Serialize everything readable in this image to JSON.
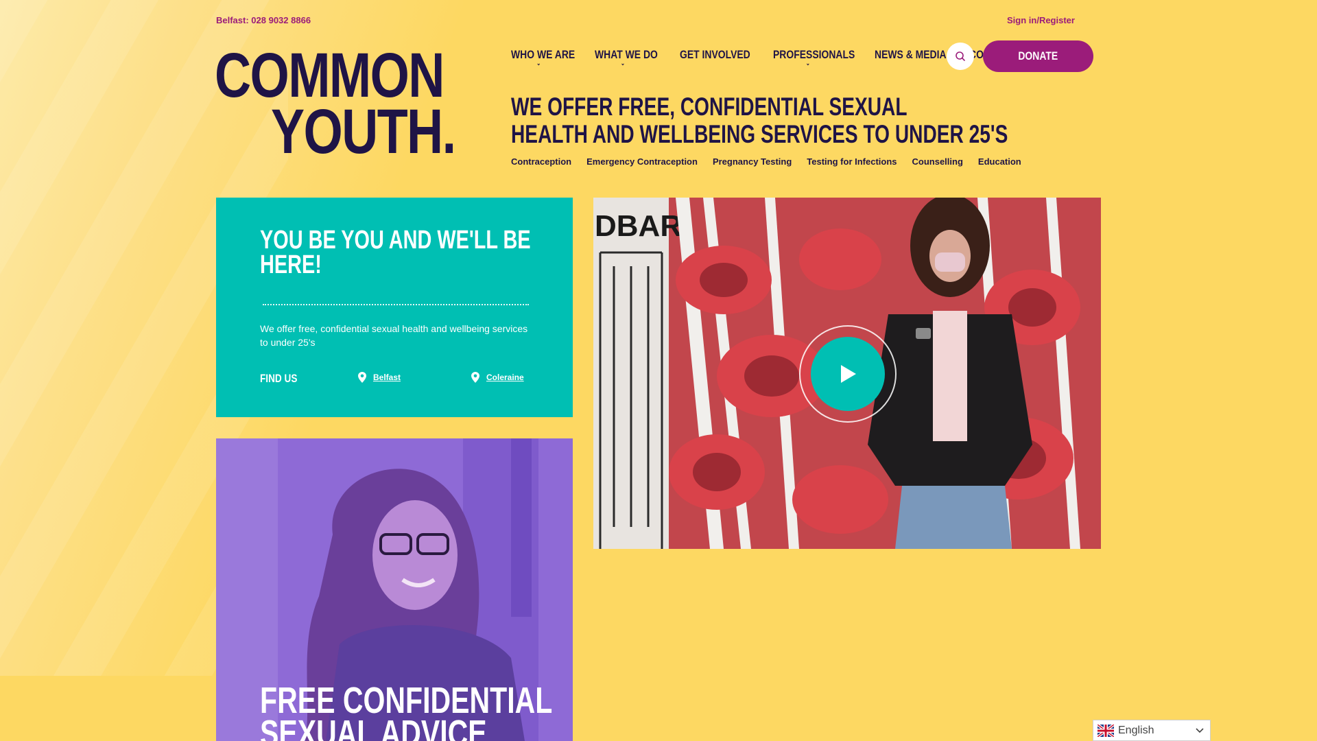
{
  "colors": {
    "background": "#fdd862",
    "brand_navy": "#1f1446",
    "brand_magenta": "#9b1c7a",
    "teal": "#00bfb3",
    "purple": "#8f6bd8"
  },
  "topbar": {
    "phone": "Belfast: 028 9032 8866",
    "signin": "Sign in/Register"
  },
  "logo": {
    "line1": "COMMON",
    "line2": "YOUTH."
  },
  "nav": {
    "items": [
      {
        "label": "WHO WE ARE",
        "has_dropdown": true
      },
      {
        "label": "WHAT WE DO",
        "has_dropdown": true
      },
      {
        "label": "GET INVOLVED",
        "has_dropdown": false
      },
      {
        "label": "PROFESSIONALS",
        "has_dropdown": true
      },
      {
        "label": "NEWS & MEDIA",
        "has_dropdown": false
      },
      {
        "label": "CONTACT",
        "has_dropdown": false
      }
    ],
    "search_icon": "search-icon",
    "donate_label": "DONATE"
  },
  "hero": {
    "headline_line1": "WE OFFER FREE, CONFIDENTIAL SEXUAL",
    "headline_line2": "HEALTH AND WELLBEING SERVICES TO UNDER 25'S",
    "services": [
      "Contraception",
      "Emergency Contraception",
      "Pregnancy Testing",
      "Testing for Infections",
      "Counselling",
      "Education"
    ]
  },
  "teal_card": {
    "title_line1": "YOU BE YOU AND WE'LL BE",
    "title_line2": "HERE!",
    "description": "We offer free, confidential sexual health and wellbeing services to under 25's",
    "find_us": "FIND US",
    "locations": [
      "Belfast",
      "Coleraine"
    ],
    "location_icon": "map-pin-icon"
  },
  "video": {
    "play_icon": "play-icon"
  },
  "purple_card": {
    "title_line1": "FREE CONFIDENTIAL",
    "title_line2": "SEXUAL ADVICE"
  },
  "language": {
    "label": "English",
    "flag_icon": "uk-flag-icon",
    "chevron_icon": "chevron-down-icon"
  }
}
